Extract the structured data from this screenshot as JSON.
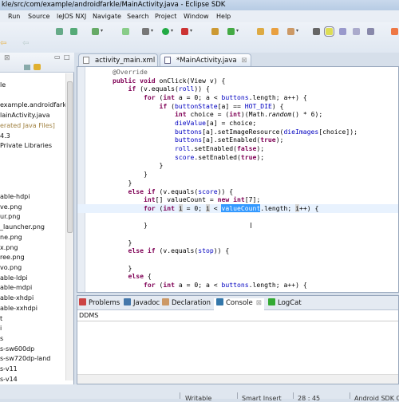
{
  "window": {
    "title": "kle/src/com/example/androidfarkle/MainActivity.java - Eclipse SDK"
  },
  "menu": [
    "Run",
    "Source",
    "leJOS NXJ",
    "Navigate",
    "Search",
    "Project",
    "Window",
    "Help"
  ],
  "toolbar": {
    "icons": [
      "download-sdk-icon",
      "avd-manager-icon",
      "checkbox-icon",
      "new-android-xml-icon",
      "debug-icon",
      "run-icon",
      "external-tools-icon",
      "new-package-icon",
      "new-class-icon",
      "open-type-icon",
      "open-folder-icon",
      "search-icon",
      "pin-icon",
      "highlight-icon",
      "show-whitespace-icon",
      "block-selection-icon",
      "paragraph-icon",
      "java-perspective-icon"
    ],
    "nav": [
      "back-icon",
      "forward-icon"
    ]
  },
  "explorer": {
    "rows": [
      "le",
      "",
      "example.androidfarkle",
      "lainActivity.java",
      "erated Java Files]",
      "4.3",
      "Private Libraries",
      "",
      "",
      "",
      "",
      "able-hdpi",
      "ve.png",
      "ur.png",
      "_launcher.png",
      "ne.png",
      "x.png",
      "ree.png",
      "vo.png",
      "able-ldpi",
      "able-mdpi",
      "able-xhdpi",
      "able-xxhdpi",
      "t",
      "i",
      "s",
      "s-sw600dp",
      "s-sw720dp-land",
      "s-v11",
      "s-v14"
    ],
    "generated_color": "#a08040"
  },
  "editor": {
    "tabs": [
      {
        "label": "activity_main.xml",
        "active": false
      },
      {
        "label": "*MainActivity.java",
        "active": true
      }
    ],
    "lines": [
      "@Override",
      "public void onClick(View v) {",
      "    if (v.equals(roll)) {",
      "        for (int a = 0; a < buttons.length; a++) {",
      "            if (buttonState[a] == HOT_DIE) {",
      "                int choice = (int)(Math.random() * 6);",
      "                dieValue[a] = choice;",
      "                buttons[a].setImageResource(dieImages[choice]);",
      "                buttons[a].setEnabled(true);",
      "                roll.setEnabled(false);",
      "                score.setEnabled(true);",
      "            }",
      "        }",
      "    }",
      "    else if (v.equals(score)) {",
      "        int[] valueCount = new int[7];",
      "        for (int i = 0; i < valueCount.length; i++) {",
      "            ",
      "        }",
      "",
      "    }",
      "    else if (v.equals(stop)) {",
      "",
      "    }",
      "    else {",
      "        for (int a = 0; a < buttons.length; a++) {"
    ],
    "current_line": 16,
    "selected_text": "valueCount"
  },
  "bottom": {
    "tabs": [
      {
        "label": "Problems",
        "icon": "problems-icon"
      },
      {
        "label": "Javadoc",
        "icon": "javadoc-icon"
      },
      {
        "label": "Declaration",
        "icon": "declaration-icon"
      },
      {
        "label": "Console",
        "icon": "console-icon",
        "active": true
      },
      {
        "label": "LogCat",
        "icon": "logcat-icon"
      }
    ],
    "console_title": "DDMS"
  },
  "status": {
    "writable": "Writable",
    "insert_mode": "Smart Insert",
    "position": "28 : 45",
    "sdk": "Android SDK C"
  },
  "colors": {
    "keyword": "#7f0055",
    "field": "#0000c0",
    "selection": "#3399ff",
    "current_line": "#e8f2fe"
  }
}
